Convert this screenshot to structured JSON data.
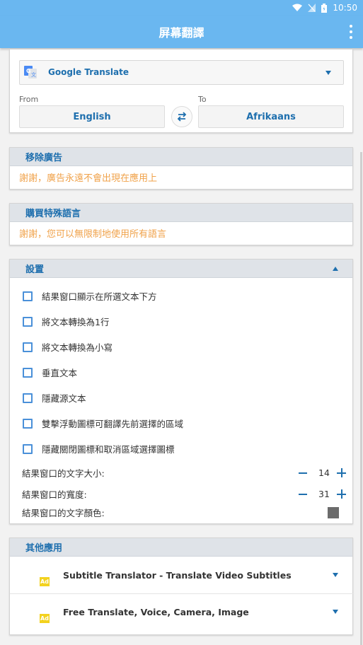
{
  "status_bar": {
    "time": "10:50"
  },
  "app_bar": {
    "title": "屏幕翻譯"
  },
  "translate": {
    "engine": "Google Translate",
    "from_label": "From",
    "to_label": "To",
    "from_lang": "English",
    "to_lang": "Afrikaans"
  },
  "remove_ads": {
    "header": "移除廣告",
    "message": "謝謝，廣告永遠不會出現在應用上"
  },
  "buy_languages": {
    "header": "購買特殊語言",
    "message": "謝謝，您可以無限制地使用所有語言"
  },
  "settings": {
    "header": "設置",
    "options": [
      {
        "label": "結果窗口顯示在所選文本下方",
        "checked": false
      },
      {
        "label": "將文本轉換為1行",
        "checked": false
      },
      {
        "label": "將文本轉換為小寫",
        "checked": false
      },
      {
        "label": "垂直文本",
        "checked": false
      },
      {
        "label": "隱藏源文本",
        "checked": false
      },
      {
        "label": "雙擊浮動圖標可翻譯先前選擇的區域",
        "checked": false
      },
      {
        "label": "隱藏關閉圖標和取消區域選擇圖標",
        "checked": false
      }
    ],
    "font_size_label": "結果窗口的文字大小:",
    "font_size_value": "14",
    "width_label": "結果窗口的寬度:",
    "width_value": "31",
    "color_label": "結果窗口的文字顏色:",
    "text_color": "#6b6b6b"
  },
  "other_apps": {
    "header": "其他應用",
    "ad_label": "Ad",
    "items": [
      {
        "title": "Subtitle Translator - Translate Video Subtitles"
      },
      {
        "title": "Free Translate, Voice, Camera, Image"
      }
    ]
  },
  "colors": {
    "primary": "#6ab7f0",
    "accent": "#1e6fae",
    "orange": "#f0a24a"
  }
}
